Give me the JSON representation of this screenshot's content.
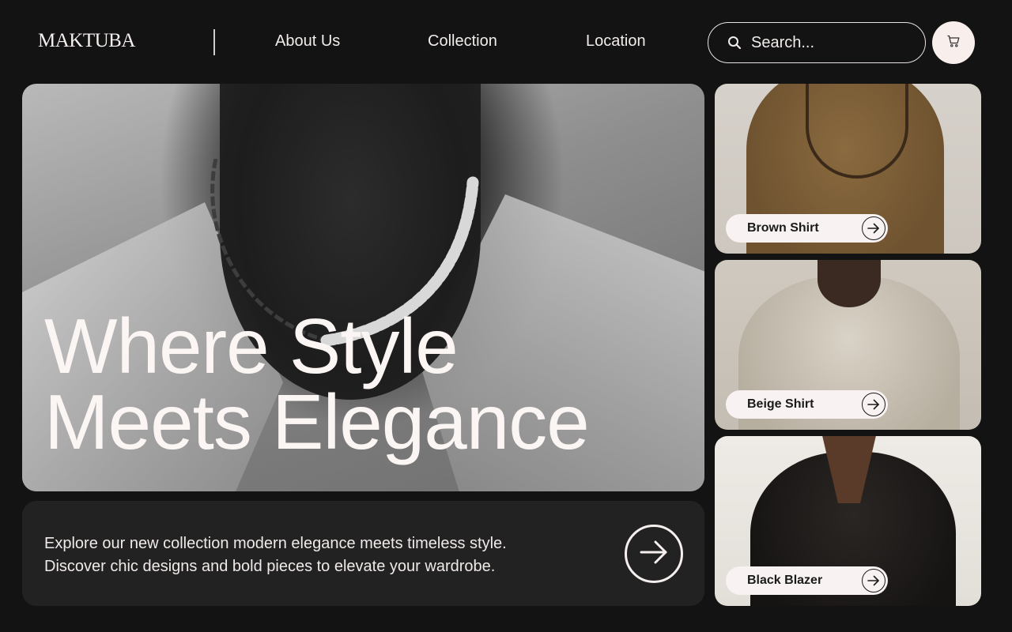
{
  "brand": {
    "logo": "MAKTUBA"
  },
  "nav": {
    "items": [
      {
        "label": "About Us"
      },
      {
        "label": "Collection"
      },
      {
        "label": "Location"
      }
    ]
  },
  "search": {
    "placeholder": "Search..."
  },
  "icons": {
    "search": "search-icon",
    "cart": "cart-icon",
    "arrow": "arrow-right-icon"
  },
  "hero": {
    "title_line1": "Where Style",
    "title_line2": "Meets Elegance"
  },
  "info": {
    "line1": "Explore our new collection modern elegance meets timeless style.",
    "line2": "Discover chic designs and bold pieces to elevate your wardrobe."
  },
  "products": [
    {
      "label": "Brown Shirt"
    },
    {
      "label": "Beige Shirt"
    },
    {
      "label": "Black Blazer"
    }
  ],
  "colors": {
    "background": "#131313",
    "panel": "#222222",
    "accent_light": "#f8eeec",
    "text": "#f5efee"
  }
}
